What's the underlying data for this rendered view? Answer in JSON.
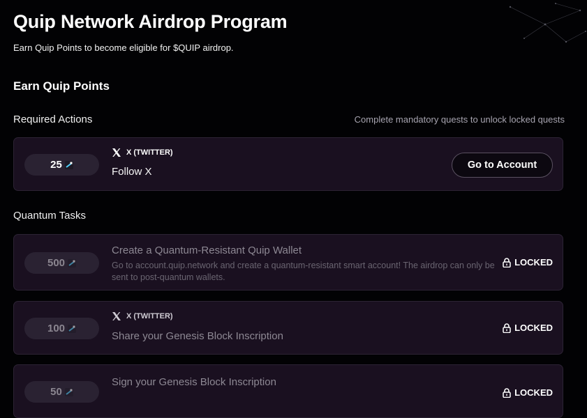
{
  "header": {
    "title": "Quip Network Airdrop Program",
    "subtitle": "Earn Quip Points to become eligible for $QUIP airdrop."
  },
  "section_title": "Earn Quip Points",
  "required": {
    "label": "Required Actions",
    "hint": "Complete mandatory quests to unlock locked quests",
    "tasks": [
      {
        "points": "25",
        "platform": "X (TWITTER)",
        "title": "Follow X",
        "action": "Go to Account"
      }
    ]
  },
  "quantum": {
    "label": "Quantum Tasks",
    "tasks": [
      {
        "points": "500",
        "title": "Create a Quantum-Resistant Quip Wallet",
        "description": "Go to account.quip.network and create a quantum-resistant smart account! The airdrop can only be sent to post-quantum wallets.",
        "status": "LOCKED"
      },
      {
        "points": "100",
        "platform": "X (TWITTER)",
        "title": "Share your Genesis Block Inscription",
        "status": "LOCKED"
      },
      {
        "points": "50",
        "title": "Sign your Genesis Block Inscription",
        "status": "LOCKED"
      }
    ]
  },
  "icons": {
    "points": "quip-points-icon",
    "platform": "x-logo-icon",
    "lock": "lock-icon"
  },
  "colors": {
    "background": "#020204",
    "card": "#1a1020",
    "card_border": "#2c2334",
    "points_pill": "#2a2232",
    "muted_text": "#a7a4b0"
  }
}
